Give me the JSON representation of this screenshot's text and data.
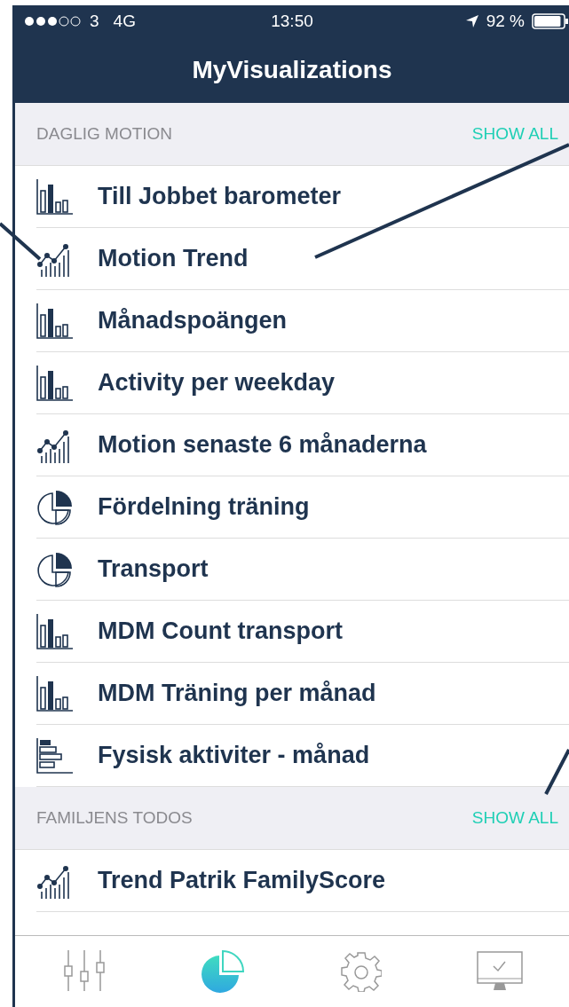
{
  "status_bar": {
    "carrier": "3",
    "network": "4G",
    "time": "13:50",
    "battery": "92 %"
  },
  "title": "MyVisualizations",
  "sections": [
    {
      "title": "DAGLIG MOTION",
      "action": "SHOW ALL",
      "items": [
        {
          "label": "Till Jobbet barometer",
          "kind": "bar"
        },
        {
          "label": "Motion Trend",
          "kind": "trend"
        },
        {
          "label": "Månadspoängen",
          "kind": "bar"
        },
        {
          "label": "Activity per weekday",
          "kind": "bar"
        },
        {
          "label": "Motion senaste 6 månaderna",
          "kind": "trend"
        },
        {
          "label": "Fördelning träning",
          "kind": "pie"
        },
        {
          "label": "Transport",
          "kind": "pie"
        },
        {
          "label": "MDM Count transport",
          "kind": "bar"
        },
        {
          "label": "MDM Träning per månad",
          "kind": "bar"
        },
        {
          "label": "Fysisk aktiviter - månad",
          "kind": "hbar"
        }
      ]
    },
    {
      "title": "FAMILJENS TODOS",
      "action": "SHOW ALL",
      "items": [
        {
          "label": "Trend Patrik FamilyScore",
          "kind": "trend"
        }
      ]
    }
  ],
  "tabs": [
    {
      "kind": "sliders",
      "selected": false
    },
    {
      "kind": "pie",
      "selected": true
    },
    {
      "kind": "gear",
      "selected": false
    },
    {
      "kind": "monitor",
      "selected": false
    }
  ]
}
